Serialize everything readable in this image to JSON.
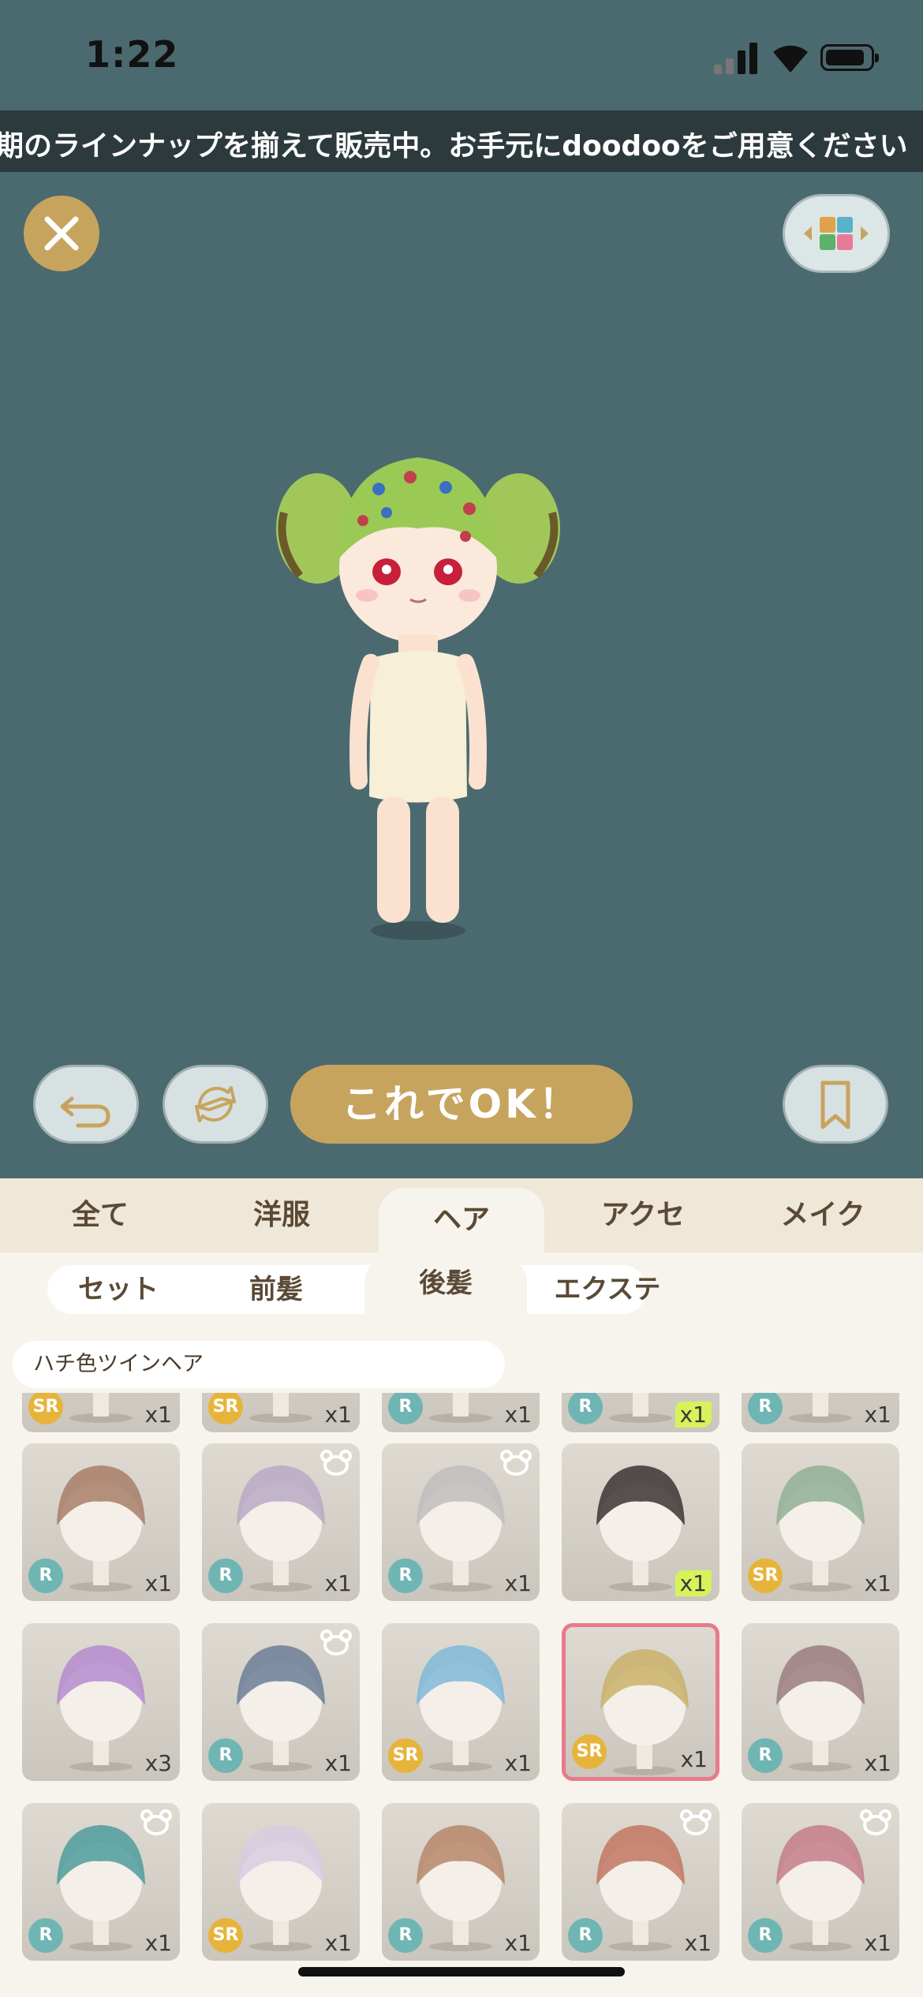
{
  "status": {
    "time": "1:22"
  },
  "ticker": {
    "text": "期のラインナップを揃えて販売中。お手元にdoodooをご用意ください"
  },
  "controls": {
    "ok_label": "これでOK！"
  },
  "category_tabs": [
    "全て",
    "洋服",
    "ヘア",
    "アクセ",
    "メイク"
  ],
  "sub_tabs": [
    "セット",
    "前髪",
    "後髪",
    "エクステ"
  ],
  "selected_item_name": "ハチ色ツインヘア",
  "items": [
    {
      "rarity": "SR",
      "count": "x1",
      "hair": "#d6c9c2"
    },
    {
      "rarity": "SR",
      "count": "x1",
      "hair": "#b7a6c4"
    },
    {
      "rarity": "R",
      "count": "x1",
      "hair": "#d0d0d0"
    },
    {
      "rarity": "R",
      "count": "x1",
      "hair": "#d0d0d0"
    },
    {
      "rarity": "R",
      "count": "x1",
      "hair": "#d0d0d0"
    },
    {
      "rarity": "R",
      "count": "x1",
      "hair": "#a77e68"
    },
    {
      "rarity": "R",
      "count": "x1",
      "hair": "#b8a9c5"
    },
    {
      "rarity": "R",
      "count": "x1",
      "hair": "#bfbdbd"
    },
    {
      "rarity": "",
      "count": "x1",
      "hair": "#3b3433"
    },
    {
      "rarity": "SR",
      "count": "x1",
      "hair": "#8fb094"
    },
    {
      "rarity": "",
      "count": "x3",
      "hair": "#b58bcf"
    },
    {
      "rarity": "R",
      "count": "x1",
      "hair": "#6b7e98"
    },
    {
      "rarity": "SR",
      "count": "x1",
      "hair": "#7fb8d8"
    },
    {
      "rarity": "SR",
      "count": "x1",
      "hair": "#c9b26a"
    },
    {
      "rarity": "R",
      "count": "x1",
      "hair": "#9a7d80"
    },
    {
      "rarity": "R",
      "count": "x1",
      "hair": "#4e9c9c"
    },
    {
      "rarity": "SR",
      "count": "x1",
      "hair": "#d7cde0"
    },
    {
      "rarity": "R",
      "count": "x1",
      "hair": "#b6876a"
    },
    {
      "rarity": "R",
      "count": "x1",
      "hair": "#c27761"
    },
    {
      "rarity": "R",
      "count": "x1",
      "hair": "#c47d8b"
    }
  ]
}
